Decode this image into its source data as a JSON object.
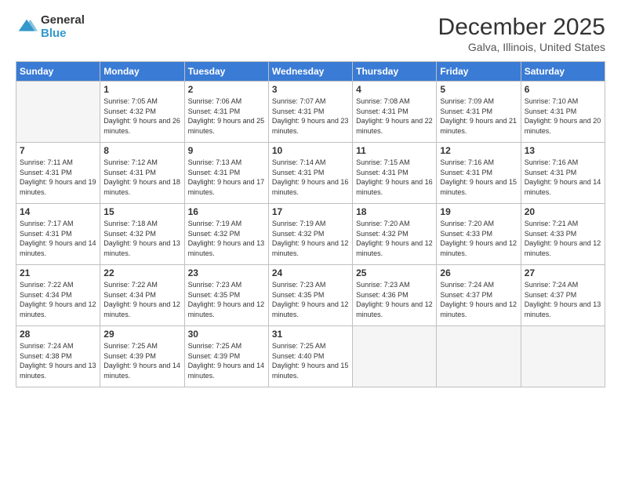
{
  "header": {
    "logo": {
      "line1": "General",
      "line2": "Blue"
    },
    "title": "December 2025",
    "location": "Galva, Illinois, United States"
  },
  "days_of_week": [
    "Sunday",
    "Monday",
    "Tuesday",
    "Wednesday",
    "Thursday",
    "Friday",
    "Saturday"
  ],
  "weeks": [
    [
      {
        "day": "",
        "sunrise": "",
        "sunset": "",
        "daylight": ""
      },
      {
        "day": "1",
        "sunrise": "7:05 AM",
        "sunset": "4:32 PM",
        "daylight": "9 hours and 26 minutes."
      },
      {
        "day": "2",
        "sunrise": "7:06 AM",
        "sunset": "4:31 PM",
        "daylight": "9 hours and 25 minutes."
      },
      {
        "day": "3",
        "sunrise": "7:07 AM",
        "sunset": "4:31 PM",
        "daylight": "9 hours and 23 minutes."
      },
      {
        "day": "4",
        "sunrise": "7:08 AM",
        "sunset": "4:31 PM",
        "daylight": "9 hours and 22 minutes."
      },
      {
        "day": "5",
        "sunrise": "7:09 AM",
        "sunset": "4:31 PM",
        "daylight": "9 hours and 21 minutes."
      },
      {
        "day": "6",
        "sunrise": "7:10 AM",
        "sunset": "4:31 PM",
        "daylight": "9 hours and 20 minutes."
      }
    ],
    [
      {
        "day": "7",
        "sunrise": "7:11 AM",
        "sunset": "4:31 PM",
        "daylight": "9 hours and 19 minutes."
      },
      {
        "day": "8",
        "sunrise": "7:12 AM",
        "sunset": "4:31 PM",
        "daylight": "9 hours and 18 minutes."
      },
      {
        "day": "9",
        "sunrise": "7:13 AM",
        "sunset": "4:31 PM",
        "daylight": "9 hours and 17 minutes."
      },
      {
        "day": "10",
        "sunrise": "7:14 AM",
        "sunset": "4:31 PM",
        "daylight": "9 hours and 16 minutes."
      },
      {
        "day": "11",
        "sunrise": "7:15 AM",
        "sunset": "4:31 PM",
        "daylight": "9 hours and 16 minutes."
      },
      {
        "day": "12",
        "sunrise": "7:16 AM",
        "sunset": "4:31 PM",
        "daylight": "9 hours and 15 minutes."
      },
      {
        "day": "13",
        "sunrise": "7:16 AM",
        "sunset": "4:31 PM",
        "daylight": "9 hours and 14 minutes."
      }
    ],
    [
      {
        "day": "14",
        "sunrise": "7:17 AM",
        "sunset": "4:31 PM",
        "daylight": "9 hours and 14 minutes."
      },
      {
        "day": "15",
        "sunrise": "7:18 AM",
        "sunset": "4:32 PM",
        "daylight": "9 hours and 13 minutes."
      },
      {
        "day": "16",
        "sunrise": "7:19 AM",
        "sunset": "4:32 PM",
        "daylight": "9 hours and 13 minutes."
      },
      {
        "day": "17",
        "sunrise": "7:19 AM",
        "sunset": "4:32 PM",
        "daylight": "9 hours and 12 minutes."
      },
      {
        "day": "18",
        "sunrise": "7:20 AM",
        "sunset": "4:32 PM",
        "daylight": "9 hours and 12 minutes."
      },
      {
        "day": "19",
        "sunrise": "7:20 AM",
        "sunset": "4:33 PM",
        "daylight": "9 hours and 12 minutes."
      },
      {
        "day": "20",
        "sunrise": "7:21 AM",
        "sunset": "4:33 PM",
        "daylight": "9 hours and 12 minutes."
      }
    ],
    [
      {
        "day": "21",
        "sunrise": "7:22 AM",
        "sunset": "4:34 PM",
        "daylight": "9 hours and 12 minutes."
      },
      {
        "day": "22",
        "sunrise": "7:22 AM",
        "sunset": "4:34 PM",
        "daylight": "9 hours and 12 minutes."
      },
      {
        "day": "23",
        "sunrise": "7:23 AM",
        "sunset": "4:35 PM",
        "daylight": "9 hours and 12 minutes."
      },
      {
        "day": "24",
        "sunrise": "7:23 AM",
        "sunset": "4:35 PM",
        "daylight": "9 hours and 12 minutes."
      },
      {
        "day": "25",
        "sunrise": "7:23 AM",
        "sunset": "4:36 PM",
        "daylight": "9 hours and 12 minutes."
      },
      {
        "day": "26",
        "sunrise": "7:24 AM",
        "sunset": "4:37 PM",
        "daylight": "9 hours and 12 minutes."
      },
      {
        "day": "27",
        "sunrise": "7:24 AM",
        "sunset": "4:37 PM",
        "daylight": "9 hours and 13 minutes."
      }
    ],
    [
      {
        "day": "28",
        "sunrise": "7:24 AM",
        "sunset": "4:38 PM",
        "daylight": "9 hours and 13 minutes."
      },
      {
        "day": "29",
        "sunrise": "7:25 AM",
        "sunset": "4:39 PM",
        "daylight": "9 hours and 14 minutes."
      },
      {
        "day": "30",
        "sunrise": "7:25 AM",
        "sunset": "4:39 PM",
        "daylight": "9 hours and 14 minutes."
      },
      {
        "day": "31",
        "sunrise": "7:25 AM",
        "sunset": "4:40 PM",
        "daylight": "9 hours and 15 minutes."
      },
      {
        "day": "",
        "sunrise": "",
        "sunset": "",
        "daylight": ""
      },
      {
        "day": "",
        "sunrise": "",
        "sunset": "",
        "daylight": ""
      },
      {
        "day": "",
        "sunrise": "",
        "sunset": "",
        "daylight": ""
      }
    ]
  ],
  "labels": {
    "sunrise_prefix": "Sunrise: ",
    "sunset_prefix": "Sunset: ",
    "daylight_prefix": "Daylight: "
  }
}
